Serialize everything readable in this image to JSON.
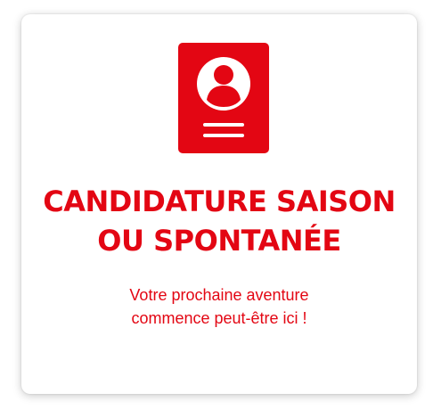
{
  "card": {
    "title_line1": "CANDIDATURE SAISON",
    "title_line2": "OU SPONTANÉE",
    "subtitle_line1": "Votre prochaine aventure",
    "subtitle_line2": "commence peut-être ici !",
    "icon": "id-badge-icon",
    "accent_color": "#e30613"
  }
}
